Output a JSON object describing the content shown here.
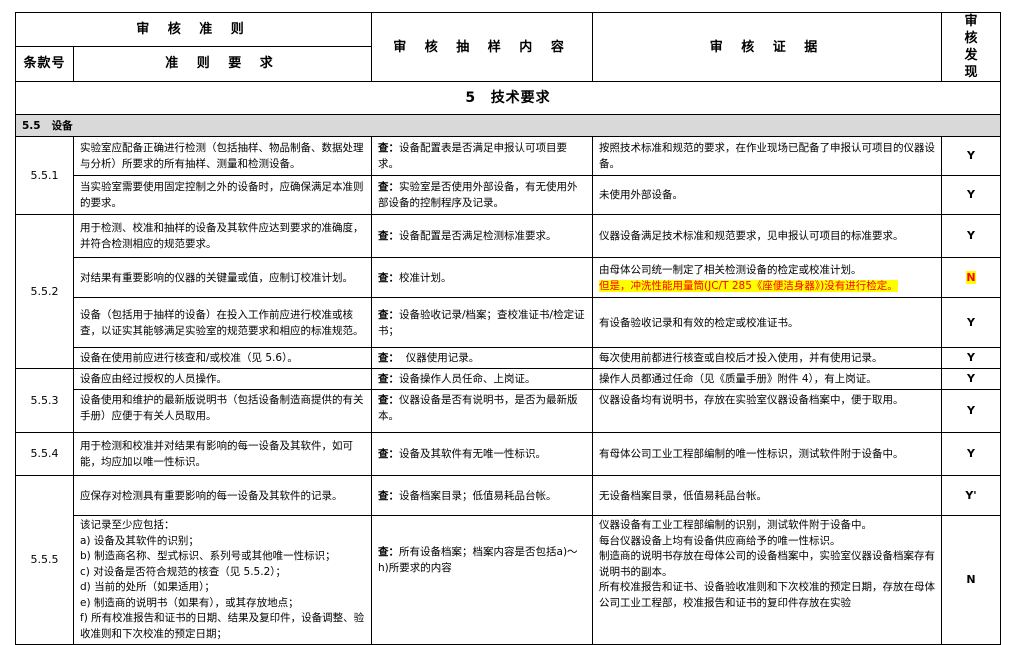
{
  "header": {
    "criteria": "审 核 准 则",
    "clause_no": "条款号",
    "criteria_req": "准 则 要 求",
    "sample": "审 核 抽 样 内 容",
    "evidence": "审 核 证 据",
    "finding": "审 核 发 现"
  },
  "section": {
    "number": "5",
    "title": "技术要求"
  },
  "subsection": {
    "number": "5.5",
    "title": "设备"
  },
  "check_prefix": "查：",
  "rows": [
    {
      "clause": "5.5.1",
      "req": "实验室应配备正确进行检测（包括抽样、物品制备、数据处理与分析）所要求的所有抽样、测量和检测设备。",
      "sample": "设备配置表是否满足申报认可项目要求。",
      "evidence": "按照技术标准和规范的要求，在作业现场已配备了申报认可项目的仪器设备。",
      "result": "Y"
    },
    {
      "req": "当实验室需要使用固定控制之外的设备时，应确保满足本准则的要求。",
      "sample": "实验室是否使用外部设备，有无使用外部设备的控制程序及记录。",
      "evidence": "未使用外部设备。",
      "result": "Y"
    },
    {
      "clause": "5.5.2",
      "req": "用于检测、校准和抽样的设备及其软件应达到要求的准确度，并符合检测相应的规范要求。",
      "sample": "设备配置是否满足检测标准要求。",
      "evidence": "仪器设备满足技术标准和规范要求，见申报认可项目的标准要求。",
      "result": "Y"
    },
    {
      "req": "对结果有重要影响的仪器的关键量或值，应制订校准计划。",
      "sample": "校准计划。",
      "evidence": "由母体公司统一制定了相关检测设备的检定或校准计划。",
      "evidence_highlight": "但是，冲洗性能用量筒(JC/T 285《座便洁身器》)没有进行检定。",
      "result": "N"
    },
    {
      "req": "设备（包括用于抽样的设备）在投入工作前应进行校准或核查，以证实其能够满足实验室的规范要求和相应的标准规范。",
      "sample": "设备验收记录/档案；查校准证书/检定证书；",
      "evidence": "有设备验收记录和有效的检定或校准证书。",
      "result": "Y"
    },
    {
      "req": "设备在使用前应进行核查和/或校准（见 5.6）。",
      "sample": "  仪器使用记录。",
      "evidence": "每次使用前都进行核查或自校后才投入使用，并有使用记录。",
      "result": "Y"
    },
    {
      "clause": "5.5.3",
      "req": "设备应由经过授权的人员操作。",
      "sample": "设备操作人员任命、上岗证。",
      "evidence": "操作人员都通过任命（见《质量手册》附件 4），有上岗证。",
      "result": "Y"
    },
    {
      "req": "设备使用和维护的最新版说明书（包括设备制造商提供的有关手册）应便于有关人员取用。",
      "sample": "仪器设备是否有说明书，是否为最新版本。",
      "evidence": "仪器设备均有说明书，存放在实验室仪器设备档案中，便于取用。",
      "result": "Y"
    },
    {
      "clause": "5.5.4",
      "req": "用于检测和校准并对结果有影响的每一设备及其软件，如可能，均应加以唯一性标识。",
      "sample": "设备及其软件有无唯一性标识。",
      "evidence": "有母体公司工业工程部编制的唯一性标识，测试软件附于设备中。",
      "result": "Y"
    },
    {
      "clause": "5.5.5",
      "req": "应保存对检测具有重要影响的每一设备及其软件的记录。",
      "sample": "设备档案目录；低值易耗品台帐。",
      "evidence": "无设备档案目录，低值易耗品台帐。",
      "result": "Y'"
    },
    {
      "req_intro": "该记录至少应包括：",
      "req_list": [
        "a)  设备及其软件的识别；",
        "b)  制造商名称、型式标识、系列号或其他唯一性标识；",
        "c)  对设备是否符合规范的核查（见 5.5.2）；",
        "d)  当前的处所（如果适用）；",
        "e)  制造商的说明书（如果有），或其存放地点；",
        "f)   所有校准报告和证书的日期、结果及复印件，设备调整、验收准则和下次校准的预定日期；"
      ],
      "sample": "所有设备档案；档案内容是否包括a)～h)所要求的内容",
      "evidence_list": [
        "仪器设备有工业工程部编制的识别，测试软件附于设备中。",
        "每台仪器设备上均有设备供应商给予的唯一性标识。",
        "制造商的说明书存放在母体公司的设备档案中，实验室仪器设备档案存有说明书的副本。",
        "所有校准报告和证书、设备验收准则和下次校准的预定日期，存放在母体公司工业工程部，校准报告和证书的复印件存放在实验"
      ],
      "result": "N"
    }
  ]
}
